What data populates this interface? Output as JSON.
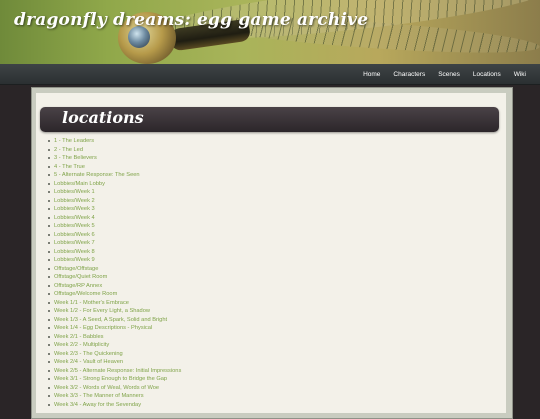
{
  "site": {
    "title": "dragonfly dreams: egg game archive"
  },
  "nav": {
    "items": [
      {
        "label": "Home"
      },
      {
        "label": "Characters"
      },
      {
        "label": "Scenes"
      },
      {
        "label": "Locations"
      },
      {
        "label": "Wiki"
      }
    ]
  },
  "page": {
    "title": "locations"
  },
  "locations": [
    "1 - The Leaders",
    "2 - The Led",
    "3 - The Believers",
    "4 - The True",
    "5 - Alternate Response: The Seen",
    "Lobbies/Main Lobby",
    "Lobbies/Week 1",
    "Lobbies/Week 2",
    "Lobbies/Week 3",
    "Lobbies/Week 4",
    "Lobbies/Week 5",
    "Lobbies/Week 6",
    "Lobbies/Week 7",
    "Lobbies/Week 8",
    "Lobbies/Week 9",
    "Offstage/Offstage",
    "Offstage/Quiet Room",
    "Offstage/RP Annex",
    "Offstage/Welcome Room",
    "Week 1/1 - Mother's Embrace",
    "Week 1/2 - For Every Light, a Shadow",
    "Week 1/3 - A Seed, A Spark, Solid and Bright",
    "Week 1/4 - Egg Descriptions - Physical",
    "Week 2/1 - Babbles",
    "Week 2/2 - Multiplicity",
    "Week 2/3 - The Quickening",
    "Week 2/4 - Vault of Heaven",
    "Week 2/5 - Alternate Response: Initial Impressions",
    "Week 3/1 - Strong Enough to Bridge the Gap",
    "Week 3/2 - Words of Weal, Words of Woe",
    "Week 3/3 - The Manner of Manners",
    "Week 3/4 - Away for the Sevenday"
  ],
  "colors": {
    "link": "#7fa348",
    "background": "#2a2527",
    "content": "#f3f1e9",
    "title_bar": "#2c262a"
  }
}
